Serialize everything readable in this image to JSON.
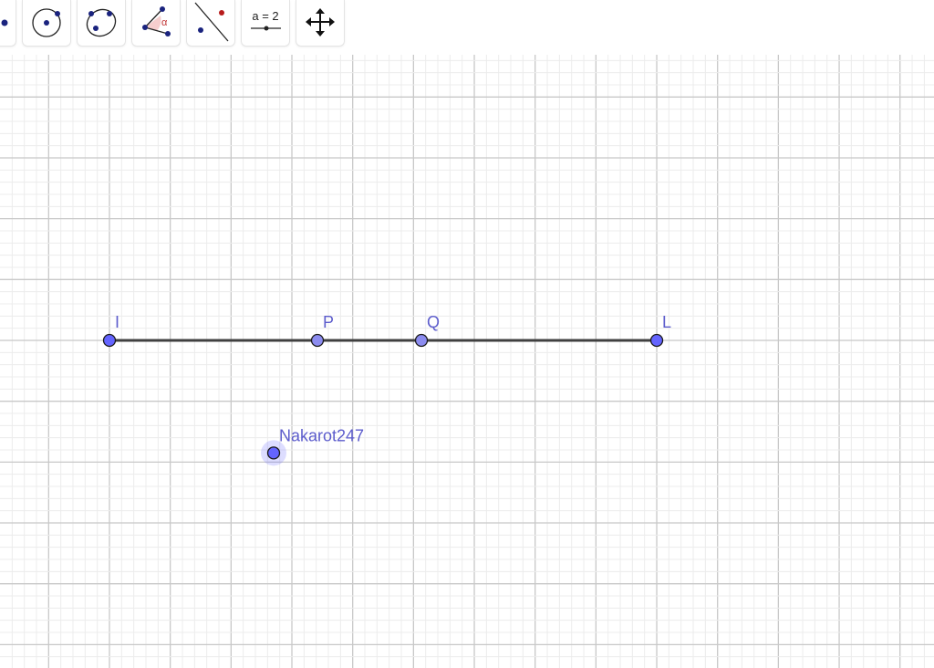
{
  "toolbar": {
    "tools": [
      {
        "name": "point-tool"
      },
      {
        "name": "circle-center-point-tool"
      },
      {
        "name": "circle-three-points-tool"
      },
      {
        "name": "angle-tool",
        "glyph": "α"
      },
      {
        "name": "perpendicular-line-tool"
      },
      {
        "name": "slider-tool",
        "label": "a = 2"
      },
      {
        "name": "move-graphics-view-tool"
      }
    ]
  },
  "construction": {
    "segment": {
      "from": "I",
      "to": "L"
    },
    "points": [
      {
        "label": "I",
        "x": 0,
        "y": 0
      },
      {
        "label": "P",
        "x": 3.42,
        "y": 0
      },
      {
        "label": "Q",
        "x": 5.13,
        "y": 0
      },
      {
        "label": "L",
        "x": 9,
        "y": 0
      }
    ],
    "free_point": {
      "label": "Nakarot247",
      "x": 2.7,
      "y": -1.85
    }
  },
  "colors": {
    "point": "#6464ff",
    "point_light": "#8c8cf0",
    "label": "#5c5ccc",
    "segment": "#404040",
    "accent": "#c03030"
  }
}
